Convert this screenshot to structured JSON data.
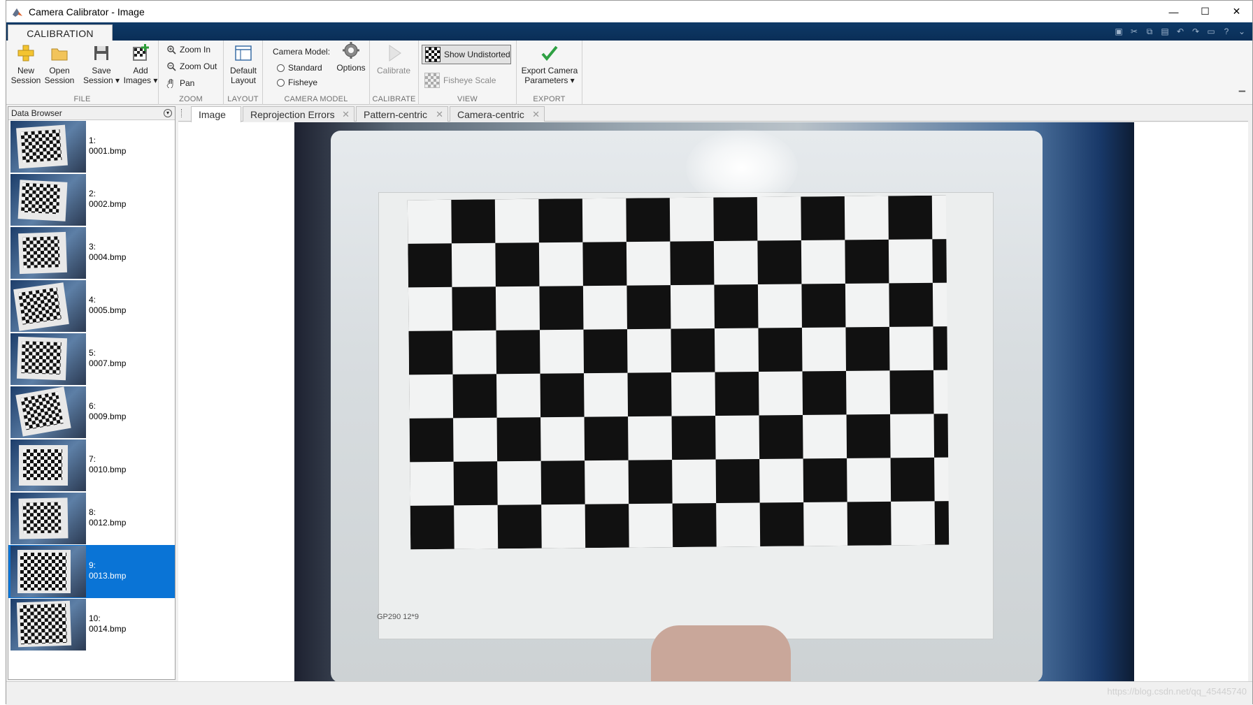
{
  "window": {
    "title": "Camera Calibrator - Image"
  },
  "window_buttons": {
    "minimize": "—",
    "maximize": "☐",
    "close": "✕"
  },
  "ribbon": {
    "tab_label": "CALIBRATION",
    "groups": {
      "file": {
        "label": "FILE",
        "new_session": [
          "New",
          "Session"
        ],
        "open_session": [
          "Open",
          "Session"
        ],
        "save_session": [
          "Save",
          "Session ▾"
        ],
        "add_images": [
          "Add",
          "Images ▾"
        ]
      },
      "zoom": {
        "label": "ZOOM",
        "zoom_in": "Zoom In",
        "zoom_out": "Zoom Out",
        "pan": "Pan"
      },
      "layout": {
        "label": "LAYOUT",
        "default_layout": [
          "Default",
          "Layout"
        ]
      },
      "camera_model": {
        "label": "CAMERA MODEL",
        "heading": "Camera Model:",
        "standard": "Standard",
        "fisheye": "Fisheye",
        "options": "Options"
      },
      "calibrate": {
        "label": "CALIBRATE",
        "calibrate": "Calibrate"
      },
      "view": {
        "label": "VIEW",
        "show_undistorted": "Show Undistorted",
        "fisheye_scale": "Fisheye Scale"
      },
      "export": {
        "label": "EXPORT",
        "export_params": [
          "Export Camera",
          "Parameters ▾"
        ]
      }
    }
  },
  "data_browser": {
    "title": "Data Browser",
    "selected_index": 8,
    "items": [
      {
        "index": "1:",
        "file": "0001.bmp"
      },
      {
        "index": "2:",
        "file": "0002.bmp"
      },
      {
        "index": "3:",
        "file": "0004.bmp"
      },
      {
        "index": "4:",
        "file": "0005.bmp"
      },
      {
        "index": "5:",
        "file": "0007.bmp"
      },
      {
        "index": "6:",
        "file": "0009.bmp"
      },
      {
        "index": "7:",
        "file": "0010.bmp"
      },
      {
        "index": "8:",
        "file": "0012.bmp"
      },
      {
        "index": "9:",
        "file": "0013.bmp"
      },
      {
        "index": "10:",
        "file": "0014.bmp"
      }
    ]
  },
  "doc_tabs": [
    "Image",
    "Reprojection Errors",
    "Pattern-centric",
    "Camera-centric"
  ],
  "active_tab": "Image",
  "image": {
    "stamp_text": "GP290  12*9"
  },
  "watermark": "https://blog.csdn.net/qq_45445740"
}
